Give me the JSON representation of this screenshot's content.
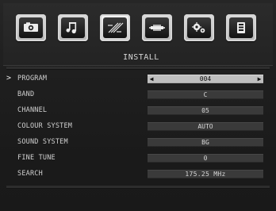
{
  "app": {
    "title": "INSTALL"
  },
  "tabs": [
    {
      "icon": "picture-icon",
      "active": false
    },
    {
      "icon": "music-note-icon",
      "active": false
    },
    {
      "icon": "tools-icon",
      "active": true
    },
    {
      "icon": "connector-icon",
      "active": false
    },
    {
      "icon": "settings-gear-icon",
      "active": false
    },
    {
      "icon": "panel-icon",
      "active": false
    }
  ],
  "menu": {
    "items": [
      {
        "label": "PROGRAM",
        "value": "004",
        "selected": true
      },
      {
        "label": "BAND",
        "value": "C",
        "selected": false
      },
      {
        "label": "CHANNEL",
        "value": "05",
        "selected": false
      },
      {
        "label": "COLOUR SYSTEM",
        "value": "AUTO",
        "selected": false
      },
      {
        "label": "SOUND SYSTEM",
        "value": "BG",
        "selected": false
      },
      {
        "label": "FINE TUNE",
        "value": "0",
        "selected": false
      },
      {
        "label": "SEARCH",
        "value": "175.25  MHz",
        "selected": false
      }
    ]
  },
  "indicators": {
    "row_arrow": ">",
    "left_arrow": "◀",
    "right_arrow": "▶"
  },
  "colors": {
    "background": "#1f1f1f",
    "text": "#d0d0d0",
    "selected_box": "#bfbfbf",
    "box": "#3a3a3a"
  }
}
